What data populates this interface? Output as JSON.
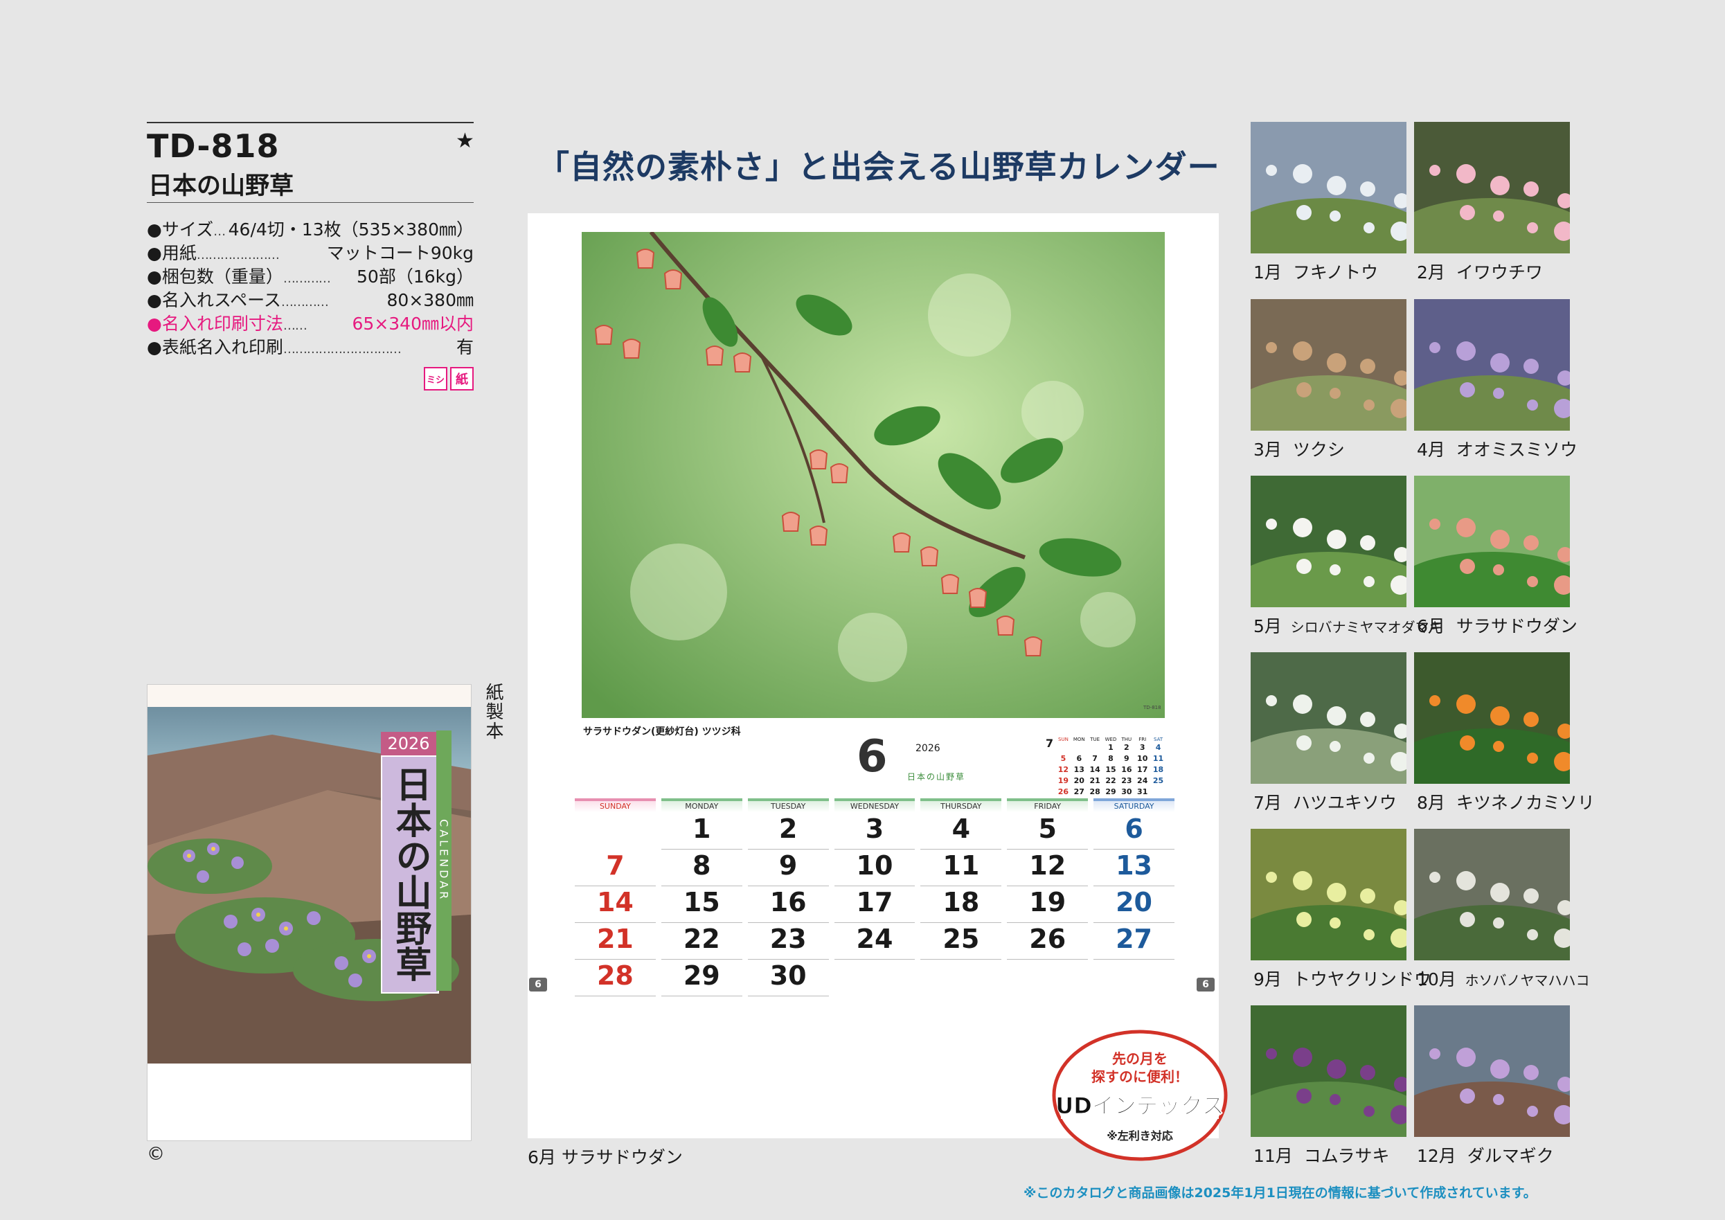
{
  "spec": {
    "code": "TD-818",
    "star": "★",
    "name": "日本の山野草",
    "rows": [
      {
        "label": "●サイズ",
        "dots": "…",
        "value": "46/4切・13枚（535×380㎜）",
        "highlight": false
      },
      {
        "label": "●用紙",
        "dots": "…………………",
        "value": "マットコート90kg",
        "highlight": false
      },
      {
        "label": "●梱包数（重量）",
        "dots": "…………",
        "value": "50部（16kg）",
        "highlight": false
      },
      {
        "label": "●名入れスペース",
        "dots": "…………",
        "value": "80×380㎜",
        "highlight": false
      },
      {
        "label": "●名入れ印刷寸法",
        "dots": "……",
        "value": "65×340㎜以内",
        "highlight": true
      },
      {
        "label": "●表紙名入れ印刷",
        "dots": "…………………………",
        "value": "有",
        "highlight": false
      }
    ],
    "badges": [
      "ミシ",
      "紙"
    ],
    "accent_color": "#e6197f"
  },
  "cover": {
    "year": "2026",
    "title": "日本の山野草",
    "calendar_word": "CALENDAR",
    "binding": "紙製本"
  },
  "copyright": "©",
  "headline": "「自然の素朴さ」と出会える山野草カレンダー",
  "sheet": {
    "flower_caption": "サラサドウダン(更紗灯台) ツツジ科",
    "month": "6",
    "year": "2026",
    "next_month": "7",
    "mini_head": [
      "SUN",
      "MON",
      "TUE",
      "WED",
      "THU",
      "FRI",
      "SAT"
    ],
    "mini_weeks": [
      [
        "",
        "",
        "",
        "1",
        "2",
        "3",
        "4"
      ],
      [
        "5",
        "6",
        "7",
        "8",
        "9",
        "10",
        "11"
      ],
      [
        "12",
        "13",
        "14",
        "15",
        "16",
        "17",
        "18"
      ],
      [
        "19",
        "20",
        "21",
        "22",
        "23",
        "24",
        "25"
      ],
      [
        "26",
        "27",
        "28",
        "29",
        "30",
        "31",
        ""
      ]
    ],
    "weekdays": [
      "SUNDAY",
      "MONDAY",
      "TUESDAY",
      "WEDNESDAY",
      "THURSDAY",
      "FRIDAY",
      "SATURDAY"
    ],
    "weeks": [
      [
        "",
        "1",
        "2",
        "3",
        "4",
        "5",
        "6"
      ],
      [
        "7",
        "8",
        "9",
        "10",
        "11",
        "12",
        "13"
      ],
      [
        "14",
        "15",
        "16",
        "17",
        "18",
        "19",
        "20"
      ],
      [
        "21",
        "22",
        "23",
        "24",
        "25",
        "26",
        "27"
      ],
      [
        "28",
        "29",
        "30",
        "",
        "",
        "",
        ""
      ]
    ],
    "tab_label": "6",
    "caption": "6月 サラサドウダン"
  },
  "ud_badge": {
    "line1": "先の月を",
    "line2": "探すのに便利！",
    "main": "UDインデックス",
    "note": "※左利き対応"
  },
  "months": [
    {
      "month": "1月",
      "name": "フキノトウ"
    },
    {
      "month": "2月",
      "name": "イワウチワ"
    },
    {
      "month": "3月",
      "name": "ツクシ"
    },
    {
      "month": "4月",
      "name": "オオミスミソウ"
    },
    {
      "month": "5月",
      "name": "シロバナミヤマオダマキ"
    },
    {
      "month": "6月",
      "name": "サラサドウダン"
    },
    {
      "month": "7月",
      "name": "ハツユキソウ"
    },
    {
      "month": "8月",
      "name": "キツネノカミソリ"
    },
    {
      "month": "9月",
      "name": "トウヤクリンドウ"
    },
    {
      "month": "10月",
      "name": "ホソバノヤマハハコ"
    },
    {
      "month": "11月",
      "name": "コムラサキ"
    },
    {
      "month": "12月",
      "name": "ダルマギク"
    }
  ],
  "footnote": "※このカタログと商品画像は2025年1月1日現在の情報に基づいて作成されています。"
}
